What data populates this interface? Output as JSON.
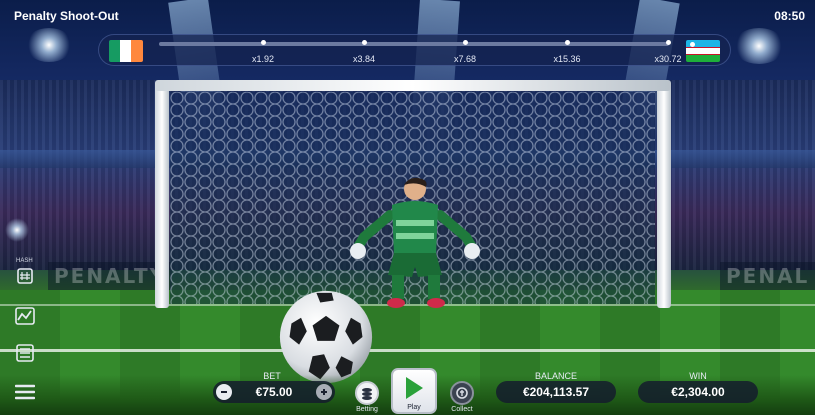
{
  "header": {
    "title": "Penalty Shoot-Out",
    "clock": "08:50"
  },
  "progress": {
    "multipliers": [
      "x1.92",
      "x3.84",
      "x7.68",
      "x15.36",
      "x30.72"
    ],
    "left_team_flag": "ireland-flag",
    "right_team_flag": "uzbekistan-flag"
  },
  "background": {
    "ad_board_left": "PENALTY\nSHOOT-OUT",
    "ad_board_right": "PENALTY\nSHOOT-OUT"
  },
  "sidebar": {
    "hash_label": "HASH",
    "items": [
      {
        "name": "hash-icon"
      },
      {
        "name": "stats-icon"
      },
      {
        "name": "history-icon"
      },
      {
        "name": "menu-icon"
      }
    ]
  },
  "controls": {
    "bet_label": "BET",
    "bet_value": "€75.00",
    "betting_label": "Betting",
    "play_label": "Play",
    "collect_label": "Collect",
    "balance_label": "BALANCE",
    "balance_value": "€204,113.57",
    "win_label": "WIN",
    "win_value": "€2,304.00"
  },
  "colors": {
    "accent": "#2f7a2a",
    "panel": "#14223f"
  }
}
